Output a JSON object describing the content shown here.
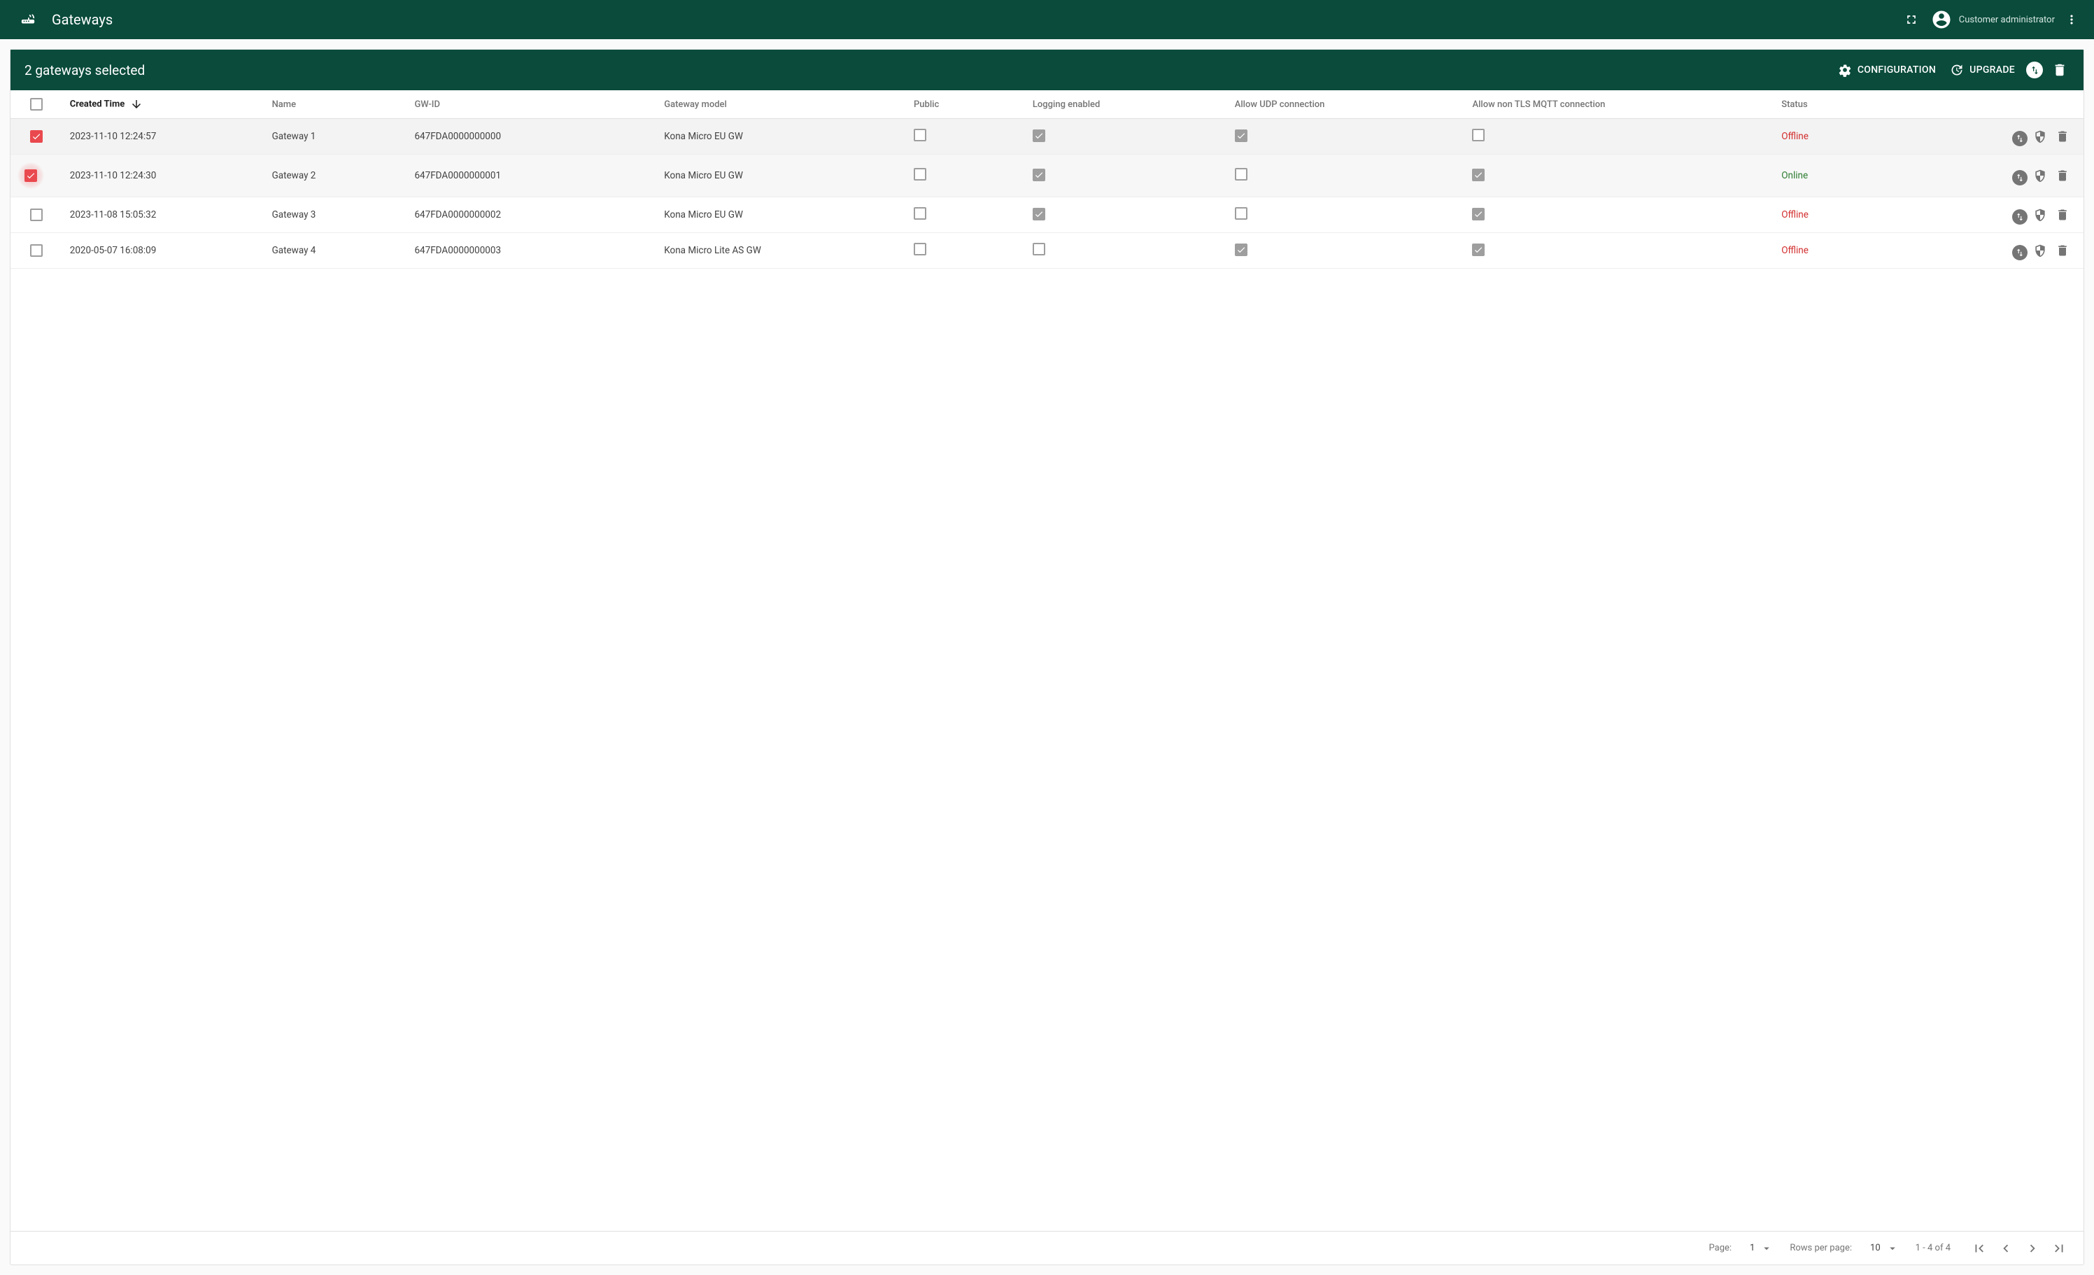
{
  "appbar": {
    "title": "Gateways",
    "user_role": "Customer administrator"
  },
  "selection": {
    "title": "2 gateways selected",
    "config_label": "CONFIGURATION",
    "upgrade_label": "UPGRADE"
  },
  "columns": {
    "created": "Created Time",
    "name": "Name",
    "gwid": "GW-ID",
    "model": "Gateway model",
    "public": "Public",
    "logging": "Logging enabled",
    "udp": "Allow UDP connection",
    "tls": "Allow non TLS MQTT connection",
    "status": "Status"
  },
  "rows": [
    {
      "selected": true,
      "halo": false,
      "created": "2023-11-10 12:24:57",
      "name": "Gateway 1",
      "gwid": "647FDA0000000000",
      "model": "Kona Micro EU GW",
      "public": false,
      "logging": true,
      "udp": true,
      "tls": false,
      "status": "Offline",
      "status_class": "status-offline"
    },
    {
      "selected": true,
      "halo": true,
      "created": "2023-11-10 12:24:30",
      "name": "Gateway 2",
      "gwid": "647FDA0000000001",
      "model": "Kona Micro EU GW",
      "public": false,
      "logging": true,
      "udp": false,
      "tls": true,
      "status": "Online",
      "status_class": "status-online"
    },
    {
      "selected": false,
      "halo": false,
      "created": "2023-11-08 15:05:32",
      "name": "Gateway 3",
      "gwid": "647FDA0000000002",
      "model": "Kona Micro EU GW",
      "public": false,
      "logging": true,
      "udp": false,
      "tls": true,
      "status": "Offline",
      "status_class": "status-offline"
    },
    {
      "selected": false,
      "halo": false,
      "created": "2020-05-07 16:08:09",
      "name": "Gateway 4",
      "gwid": "647FDA0000000003",
      "model": "Kona Micro Lite AS GW",
      "public": false,
      "logging": false,
      "udp": true,
      "tls": true,
      "status": "Offline",
      "status_class": "status-offline"
    }
  ],
  "footer": {
    "page_label": "Page:",
    "page_value": "1",
    "rows_label": "Rows per page:",
    "rows_value": "10",
    "range": "1 - 4 of 4"
  }
}
